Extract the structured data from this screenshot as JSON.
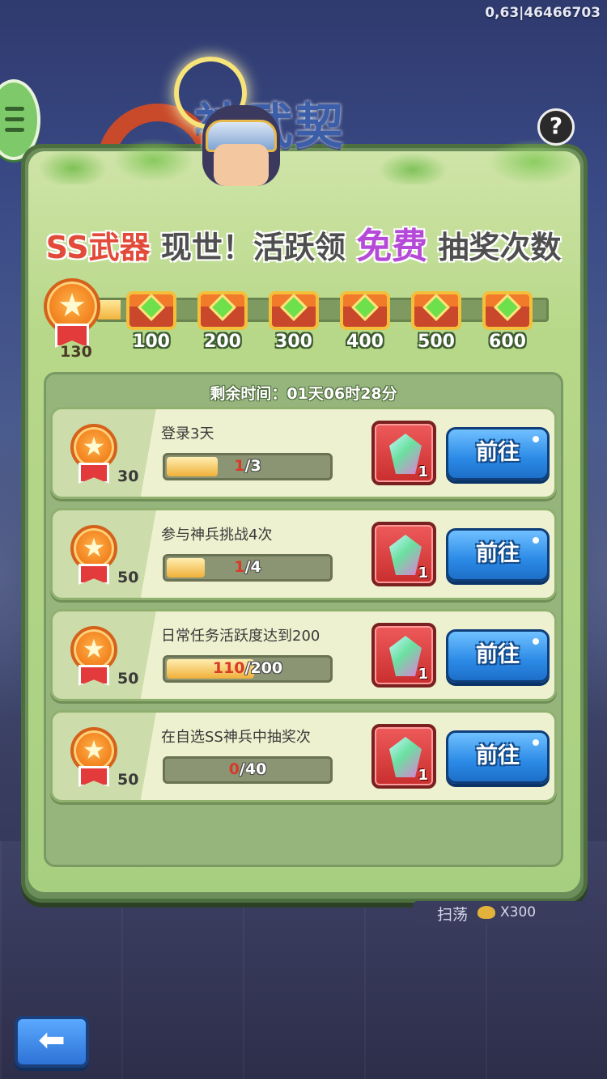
{
  "debug_id": "0,63|46466703",
  "title_art_text": "神武契",
  "help_label": "?",
  "headline": {
    "part1": "SS武器",
    "part2": "现世！活跃领",
    "part3": "免费",
    "part4": "抽奖次数"
  },
  "progress": {
    "current_points": "130",
    "fill_fraction": 0.05,
    "milestones": [
      "100",
      "200",
      "300",
      "400",
      "500",
      "600"
    ]
  },
  "time_remaining": "剩余时间：01天06时28分",
  "tasks": [
    {
      "title": "登录3天",
      "points": "30",
      "current": "1",
      "total": "/3",
      "fill": 0.33,
      "reward_count": "1",
      "button": "前往"
    },
    {
      "title": "参与神兵挑战4次",
      "points": "50",
      "current": "1",
      "total": "/4",
      "fill": 0.25,
      "reward_count": "1",
      "button": "前往"
    },
    {
      "title": "日常任务活跃度达到200",
      "points": "50",
      "current": "110",
      "total": "/200",
      "fill": 0.55,
      "reward_count": "1",
      "button": "前往"
    },
    {
      "title": "在自选SS神兵中抽奖次",
      "points": "50",
      "current": "0",
      "total": "/40",
      "fill": 0.0,
      "reward_count": "1",
      "button": "前往"
    }
  ],
  "sweep": {
    "label": "扫荡",
    "cost": "X300"
  },
  "back_icon": "back-arrow-icon"
}
